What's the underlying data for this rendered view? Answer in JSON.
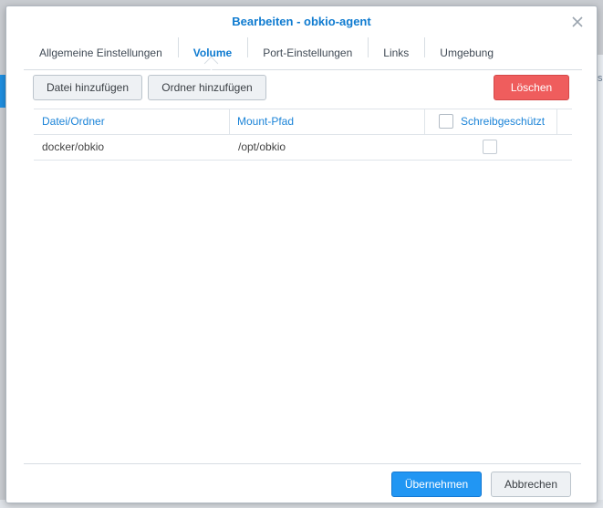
{
  "background": {
    "right_fragment": "s"
  },
  "dialog": {
    "title": "Bearbeiten - obkio-agent",
    "close_icon": "close-icon"
  },
  "tabs": [
    {
      "label": "Allgemeine Einstellungen",
      "active": false
    },
    {
      "label": "Volume",
      "active": true
    },
    {
      "label": "Port-Einstellungen",
      "active": false
    },
    {
      "label": "Links",
      "active": false
    },
    {
      "label": "Umgebung",
      "active": false
    }
  ],
  "toolbar": {
    "add_file_label": "Datei hinzufügen",
    "add_folder_label": "Ordner hinzufügen",
    "delete_label": "Löschen"
  },
  "table": {
    "headers": {
      "file_folder": "Datei/Ordner",
      "mount_path": "Mount-Pfad",
      "read_only": "Schreibgeschützt"
    },
    "rows": [
      {
        "file_folder": "docker/obkio",
        "mount_path": "/opt/obkio",
        "read_only": false
      }
    ]
  },
  "footer": {
    "apply_label": "Übernehmen",
    "cancel_label": "Abbrechen"
  },
  "colors": {
    "accent": "#0f7bd0",
    "delete": "#ef5d5d",
    "primary": "#2196f3"
  }
}
